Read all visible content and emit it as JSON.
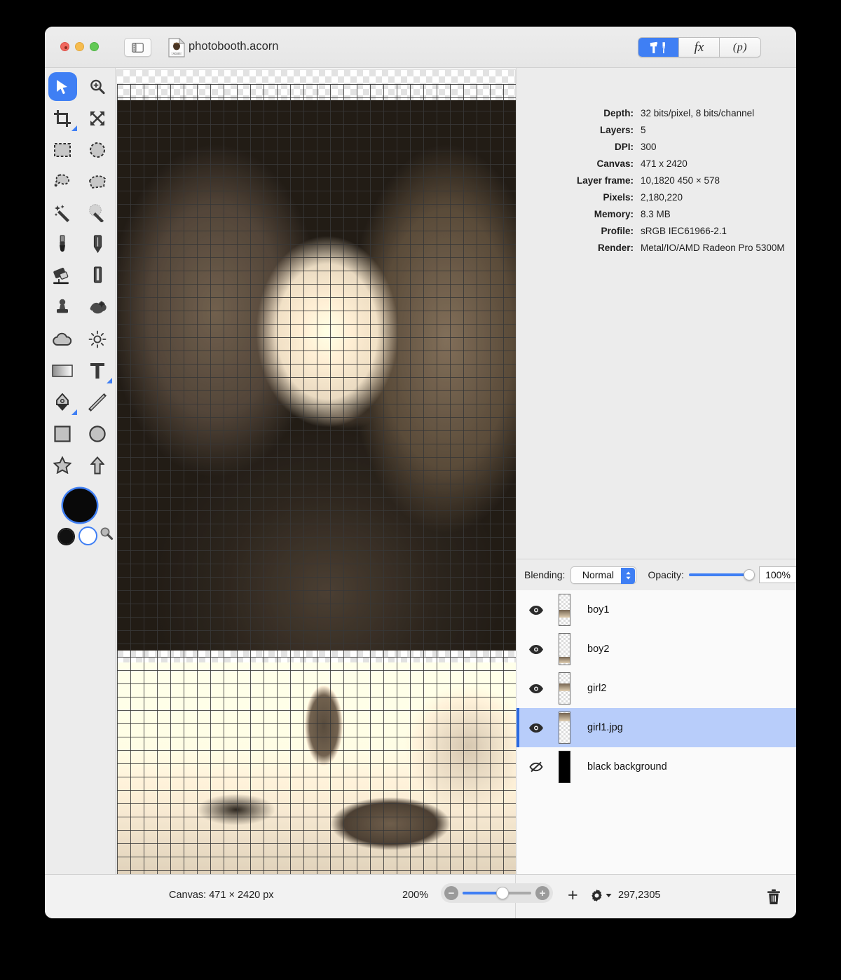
{
  "window": {
    "title": "photobooth.acorn",
    "traffic_lights": [
      "close",
      "minimize",
      "zoom"
    ],
    "sidebar_toggle_icon": "sidebar-toggle-icon",
    "document_icon": "acorn-document-icon"
  },
  "toolbar": {
    "segments": [
      {
        "id": "tools",
        "icon": "hammer-brush-icon",
        "label": "",
        "active": true
      },
      {
        "id": "filters",
        "icon": "fx-icon",
        "label": "fx",
        "active": false
      },
      {
        "id": "palettes",
        "icon": "p-icon",
        "label": "(p)",
        "active": false
      }
    ],
    "accent_color": "#3f7ff4"
  },
  "tools": {
    "items": [
      {
        "name": "move-tool",
        "selected": true,
        "badge": false
      },
      {
        "name": "zoom-tool",
        "selected": false,
        "badge": false
      },
      {
        "name": "crop-tool",
        "selected": false,
        "badge": true
      },
      {
        "name": "transform-tool",
        "selected": false,
        "badge": false
      },
      {
        "name": "rectangular-selection-tool",
        "selected": false,
        "badge": false
      },
      {
        "name": "elliptical-selection-tool",
        "selected": false,
        "badge": false
      },
      {
        "name": "lasso-selection-tool",
        "selected": false,
        "badge": false
      },
      {
        "name": "polygon-selection-tool",
        "selected": false,
        "badge": false
      },
      {
        "name": "magic-wand-tool",
        "selected": false,
        "badge": false
      },
      {
        "name": "instant-alpha-tool",
        "selected": false,
        "badge": false
      },
      {
        "name": "brush-tool",
        "selected": false,
        "badge": false
      },
      {
        "name": "pencil-tool",
        "selected": false,
        "badge": false
      },
      {
        "name": "eraser-tool",
        "selected": false,
        "badge": false
      },
      {
        "name": "marker-tool",
        "selected": false,
        "badge": false
      },
      {
        "name": "clone-stamp-tool",
        "selected": false,
        "badge": false
      },
      {
        "name": "smudge-tool",
        "selected": false,
        "badge": false
      },
      {
        "name": "blur-tool",
        "selected": false,
        "badge": false
      },
      {
        "name": "dodge-tool",
        "selected": false,
        "badge": false
      },
      {
        "name": "gradient-tool",
        "selected": false,
        "badge": false
      },
      {
        "name": "text-tool",
        "selected": false,
        "badge": true
      },
      {
        "name": "bezier-pen-tool",
        "selected": false,
        "badge": true
      },
      {
        "name": "line-tool",
        "selected": false,
        "badge": false
      },
      {
        "name": "rectangle-shape-tool",
        "selected": false,
        "badge": false
      },
      {
        "name": "oval-shape-tool",
        "selected": false,
        "badge": false
      },
      {
        "name": "star-shape-tool",
        "selected": false,
        "badge": false
      },
      {
        "name": "arrow-shape-tool",
        "selected": false,
        "badge": false
      }
    ],
    "foreground_color": "#090909",
    "background_color": "#ffffff"
  },
  "info": {
    "rows": [
      {
        "label": "Depth:",
        "value": "32 bits/pixel, 8 bits/channel"
      },
      {
        "label": "Layers:",
        "value": "5"
      },
      {
        "label": "DPI:",
        "value": "300"
      },
      {
        "label": "Canvas:",
        "value": "471 x 2420"
      },
      {
        "label": "Layer frame:",
        "value": "10,1820 450 × 578"
      },
      {
        "label": "Pixels:",
        "value": "2,180,220"
      },
      {
        "label": "Memory:",
        "value": "8.3 MB"
      },
      {
        "label": "Profile:",
        "value": "sRGB IEC61966-2.1"
      },
      {
        "label": "Render:",
        "value": "Metal/IO/AMD Radeon Pro 5300M"
      }
    ]
  },
  "blending": {
    "label": "Blending:",
    "mode": "Normal",
    "opacity_label": "Opacity:",
    "opacity_value": "100%",
    "opacity_percent": 100
  },
  "layers": {
    "items": [
      {
        "name": "boy1",
        "visible": true,
        "selected": false,
        "thumb": "image"
      },
      {
        "name": "boy2",
        "visible": true,
        "selected": false,
        "thumb": "image"
      },
      {
        "name": "girl2",
        "visible": true,
        "selected": false,
        "thumb": "image"
      },
      {
        "name": "girl1.jpg",
        "visible": true,
        "selected": true,
        "thumb": "image"
      },
      {
        "name": "black background",
        "visible": false,
        "selected": false,
        "thumb": "black"
      }
    ],
    "selection_color": "#b8cdfa"
  },
  "status": {
    "canvas_size": "Canvas: 471 × 2420 px",
    "zoom": "200%",
    "coordinates": "297,2305",
    "add_icon": "plus-icon",
    "gear_icon": "gear-dropdown-icon",
    "trash_icon": "trash-icon",
    "zoom_out_icon": "zoom-out-icon",
    "zoom_in_icon": "zoom-in-icon"
  }
}
